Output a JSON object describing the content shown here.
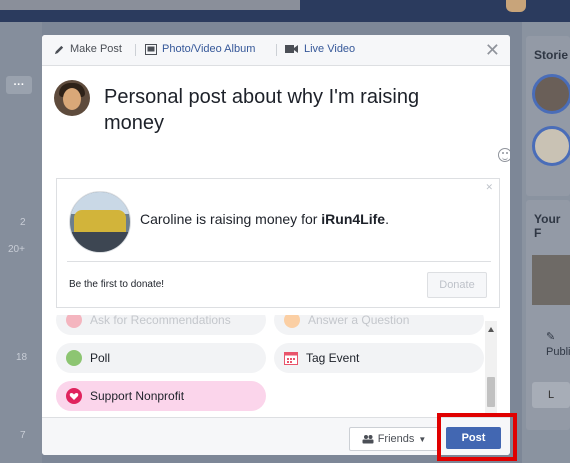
{
  "tabs": [
    {
      "label": "Make Post",
      "icon": "pencil-icon"
    },
    {
      "label": "Photo/Video Album",
      "icon": "photo-album-icon"
    },
    {
      "label": "Live Video",
      "icon": "video-camera-icon"
    }
  ],
  "composer": {
    "text": "Personal post about why I'm raising money"
  },
  "nonprofit_card": {
    "text_prefix": "Caroline is raising money for ",
    "nonprofit_name": "iRun4Life",
    "text_suffix": ".",
    "donate_prompt": "Be the first to donate!",
    "donate_label": "Donate"
  },
  "options": [
    {
      "label": "Ask for Recommendations",
      "icon": "recommendation-icon",
      "color": "#e9546b"
    },
    {
      "label": "Answer a Question",
      "icon": "question-icon",
      "color": "#f7923b"
    },
    {
      "label": "Poll",
      "icon": "poll-icon",
      "color": "#8dc572"
    },
    {
      "label": "Tag Event",
      "icon": "calendar-icon",
      "color": "#e9546b"
    },
    {
      "label": "Support Nonprofit",
      "icon": "heart-icon",
      "color": "#e0245e"
    }
  ],
  "footer": {
    "audience_label": "Friends",
    "post_label": "Post"
  },
  "background": {
    "left_numbers": [
      "2",
      "20+",
      "18",
      "7"
    ],
    "right_labels": [
      "Storie",
      "Your F",
      "Publi",
      "L"
    ]
  }
}
